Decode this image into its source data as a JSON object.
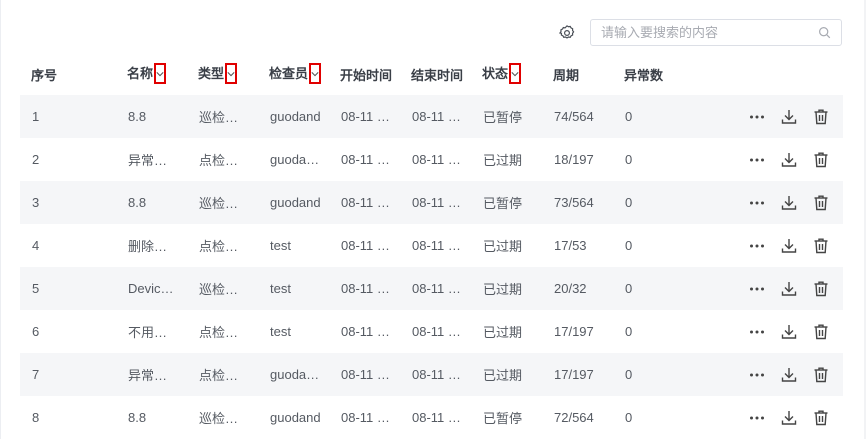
{
  "toolbar": {
    "settings_icon": "gear-icon",
    "search_placeholder": "请输入要搜索的内容",
    "search_icon": "search-icon"
  },
  "table": {
    "headers": {
      "index": "序号",
      "name": "名称",
      "type": "类型",
      "inspector": "检查员",
      "start_time": "开始时间",
      "end_time": "结束时间",
      "status": "状态",
      "period": "周期",
      "anomalies": "异常数"
    },
    "rows": [
      {
        "index": "1",
        "name": "8.8",
        "type": "巡检…",
        "inspector": "guodand",
        "start": "08-11 …",
        "end": "08-11 …",
        "status": "已暂停",
        "period": "74/564",
        "anomalies": "0"
      },
      {
        "index": "2",
        "name": "异常…",
        "type": "点检…",
        "inspector": "guoda…",
        "start": "08-11 …",
        "end": "08-11 …",
        "status": "已过期",
        "period": "18/197",
        "anomalies": "0"
      },
      {
        "index": "3",
        "name": "8.8",
        "type": "巡检…",
        "inspector": "guodand",
        "start": "08-11 …",
        "end": "08-11 …",
        "status": "已暂停",
        "period": "73/564",
        "anomalies": "0"
      },
      {
        "index": "4",
        "name": "删除…",
        "type": "点检…",
        "inspector": "test",
        "start": "08-11 …",
        "end": "08-11 …",
        "status": "已过期",
        "period": "17/53",
        "anomalies": "0"
      },
      {
        "index": "5",
        "name": "Devic…",
        "type": "巡检…",
        "inspector": "test",
        "start": "08-11 …",
        "end": "08-11 …",
        "status": "已过期",
        "period": "20/32",
        "anomalies": "0"
      },
      {
        "index": "6",
        "name": "不用…",
        "type": "点检…",
        "inspector": "test",
        "start": "08-11 …",
        "end": "08-11 …",
        "status": "已过期",
        "period": "17/197",
        "anomalies": "0"
      },
      {
        "index": "7",
        "name": "异常…",
        "type": "点检…",
        "inspector": "guoda…",
        "start": "08-11 …",
        "end": "08-11 …",
        "status": "已过期",
        "period": "17/197",
        "anomalies": "0"
      },
      {
        "index": "8",
        "name": "8.8",
        "type": "巡检…",
        "inspector": "guodand",
        "start": "08-11 …",
        "end": "08-11 …",
        "status": "已暂停",
        "period": "72/564",
        "anomalies": "0"
      }
    ],
    "row_actions": [
      "more-icon",
      "download-icon",
      "delete-icon"
    ]
  }
}
